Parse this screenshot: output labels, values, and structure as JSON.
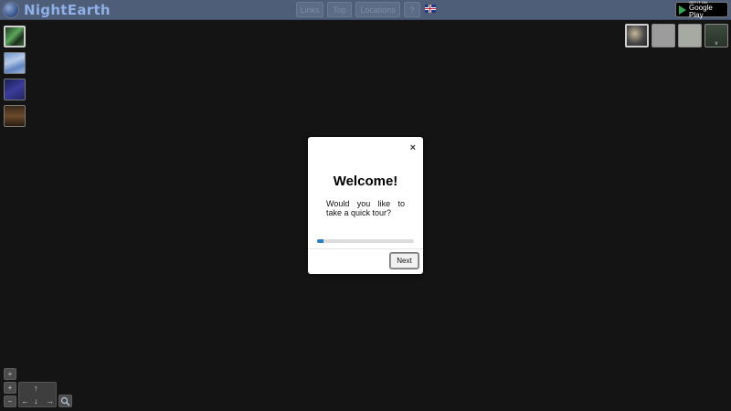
{
  "app": {
    "brand": "NightEarth"
  },
  "nav": {
    "items": [
      {
        "label": "Links"
      },
      {
        "label": "Top"
      },
      {
        "label": "Locations"
      },
      {
        "label": "?"
      }
    ],
    "language_flag": "uk-flag-icon"
  },
  "store_badge": {
    "small": "GET IT ON",
    "big": "Google Play"
  },
  "left_layers": [
    {
      "name": "aurora",
      "selected": true
    },
    {
      "name": "clouds",
      "selected": false
    },
    {
      "name": "night-sky",
      "selected": false
    },
    {
      "name": "city-lights",
      "selected": false
    }
  ],
  "right_layers": [
    {
      "name": "city-lights",
      "label": "",
      "selected": true
    },
    {
      "name": "blank-1",
      "label": ""
    },
    {
      "name": "blank-2",
      "label": ""
    },
    {
      "name": "terrain",
      "label": "v"
    }
  ],
  "map_controls": {
    "toggle": "+",
    "zoom_in": "+",
    "zoom_out": "−",
    "arrows": {
      "up": "↑",
      "left": "←",
      "down": "↓",
      "right": "→"
    },
    "search_icon": "magnifier-icon"
  },
  "modal": {
    "title": "Welcome!",
    "body": "Would you like to take a quick tour?",
    "close": "×",
    "progress": 0.07,
    "next_label": "Next"
  },
  "colors": {
    "topbar": "#4e5d78",
    "background": "#141414",
    "accent": "#2a7ec4"
  }
}
